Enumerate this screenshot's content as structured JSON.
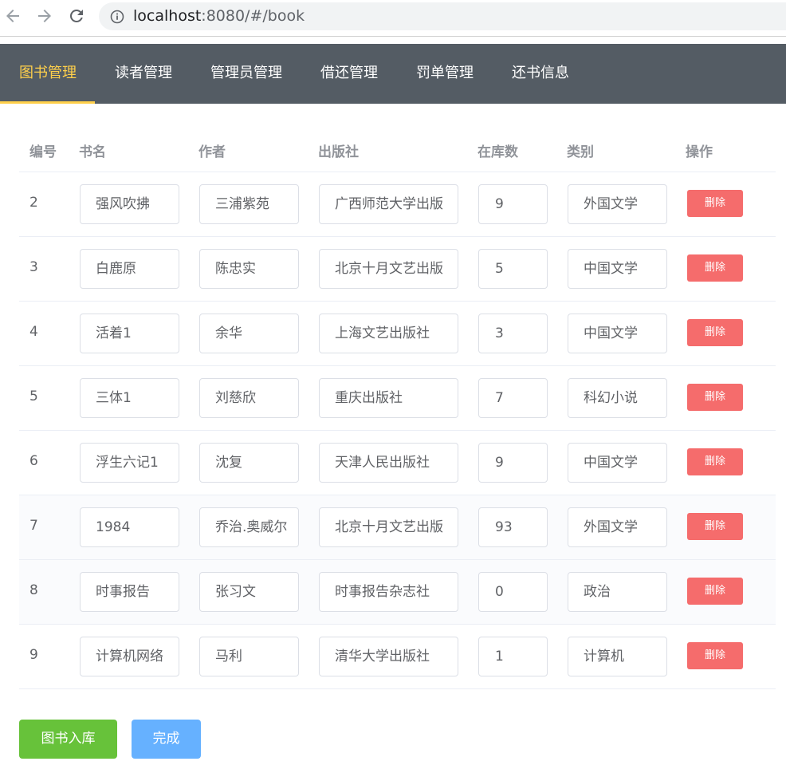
{
  "browser": {
    "url_host": "localhost",
    "url_rest": ":8080/#/book"
  },
  "menu": {
    "items": [
      {
        "label": "图书管理",
        "active": true
      },
      {
        "label": "读者管理",
        "active": false
      },
      {
        "label": "管理员管理",
        "active": false
      },
      {
        "label": "借还管理",
        "active": false
      },
      {
        "label": "罚单管理",
        "active": false
      },
      {
        "label": "还书信息",
        "active": false
      }
    ],
    "active_color": "#ffd04b",
    "background": "#545c64"
  },
  "table": {
    "headers": {
      "id": "编号",
      "name": "书名",
      "author": "作者",
      "publisher": "出版社",
      "stock": "在库数",
      "category": "类别",
      "actions": "操作"
    },
    "delete_label": "删除",
    "rows": [
      {
        "id": "2",
        "name": "强风吹拂",
        "author": "三浦紫苑",
        "publisher": "广西师范大学出版",
        "stock": "9",
        "category": "外国文学"
      },
      {
        "id": "3",
        "name": "白鹿原",
        "author": "陈忠实",
        "publisher": "北京十月文艺出版",
        "stock": "5",
        "category": "中国文学"
      },
      {
        "id": "4",
        "name": "活着1",
        "author": "余华",
        "publisher": "上海文艺出版社",
        "stock": "3",
        "category": "中国文学"
      },
      {
        "id": "5",
        "name": "三体1",
        "author": "刘慈欣",
        "publisher": "重庆出版社",
        "stock": "7",
        "category": "科幻小说"
      },
      {
        "id": "6",
        "name": "浮生六记1",
        "author": "沈复",
        "publisher": "天津人民出版社",
        "stock": "9",
        "category": "中国文学"
      },
      {
        "id": "7",
        "name": "1984",
        "author": "乔治.奥威尔",
        "publisher": "北京十月文艺出版",
        "stock": "93",
        "category": "外国文学"
      },
      {
        "id": "8",
        "name": "时事报告",
        "author": "张习文",
        "publisher": "时事报告杂志社",
        "stock": "0",
        "category": "政治"
      },
      {
        "id": "9",
        "name": "计算机网络",
        "author": "马利",
        "publisher": "清华大学出版社",
        "stock": "1",
        "category": "计算机"
      }
    ]
  },
  "buttons": {
    "add_label": "图书入库",
    "done_label": "完成",
    "add_color": "#67c23a",
    "done_color": "#66b1ff",
    "delete_color": "#f56c6c"
  },
  "icons": {
    "back": "arrow-left-icon",
    "forward": "arrow-right-icon",
    "reload": "reload-icon",
    "info": "info-icon"
  }
}
